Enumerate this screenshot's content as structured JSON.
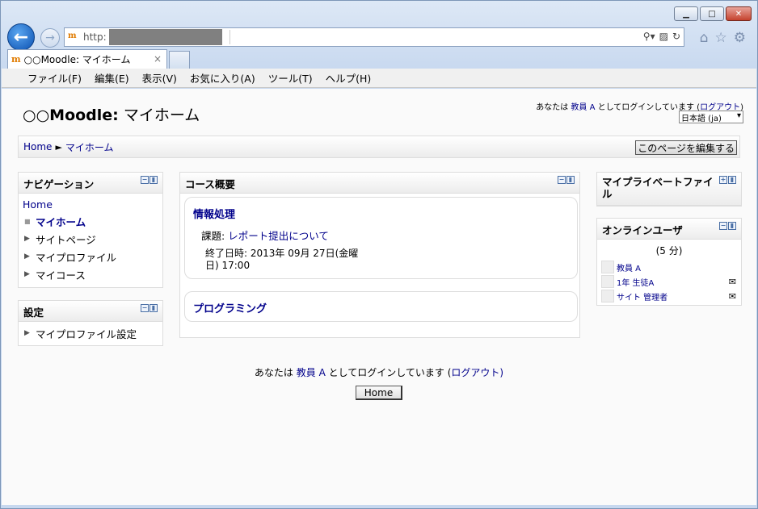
{
  "browser": {
    "address_prefix": "http:",
    "tab_title": "○○Moodle: マイホーム",
    "tab_close": "×",
    "menu": [
      "ファイル(F)",
      "編集(E)",
      "表示(V)",
      "お気に入り(A)",
      "ツール(T)",
      "ヘルプ(H)"
    ]
  },
  "header": {
    "site_title_prefix": "○○Moodle:",
    "site_title_page": " マイホーム",
    "login_text_before": "あなたは ",
    "login_user": "教員 A",
    "login_text_after": " としてログインしています (",
    "logout": "ログアウト",
    "login_close": ")",
    "language": "日本語 (ja)"
  },
  "navbar": {
    "home": "Home",
    "separator": "►",
    "current": "マイホーム",
    "edit_button": "このページを編集する"
  },
  "navigation_block": {
    "title": "ナビゲーション",
    "home": "Home",
    "items": [
      "マイホーム",
      "サイトページ",
      "マイプロファイル",
      "マイコース"
    ]
  },
  "settings_block": {
    "title": "設定",
    "items": [
      "マイプロファイル設定"
    ]
  },
  "course_overview": {
    "title": "コース概要",
    "courses": [
      {
        "name": "情報処理",
        "assignment_label": "課題: ",
        "assignment_link": "レポート提出について",
        "due_line1": "終了日時: 2013年 09月 27日(金曜",
        "due_line2": "日) 17:00"
      },
      {
        "name": "プログラミング"
      }
    ]
  },
  "private_files_block": {
    "title": "マイプライベートファイル"
  },
  "online_users_block": {
    "title": "オンラインユーザ",
    "period": "(5 分)",
    "users": [
      "教員 A",
      "1年 生徒A",
      "サイト 管理者"
    ]
  },
  "footer": {
    "login_text_before": "あなたは ",
    "login_user": "教員 A",
    "login_text_after": " としてログインしています (",
    "logout": "ログアウト",
    "login_close": ")",
    "home_button": "Home"
  }
}
